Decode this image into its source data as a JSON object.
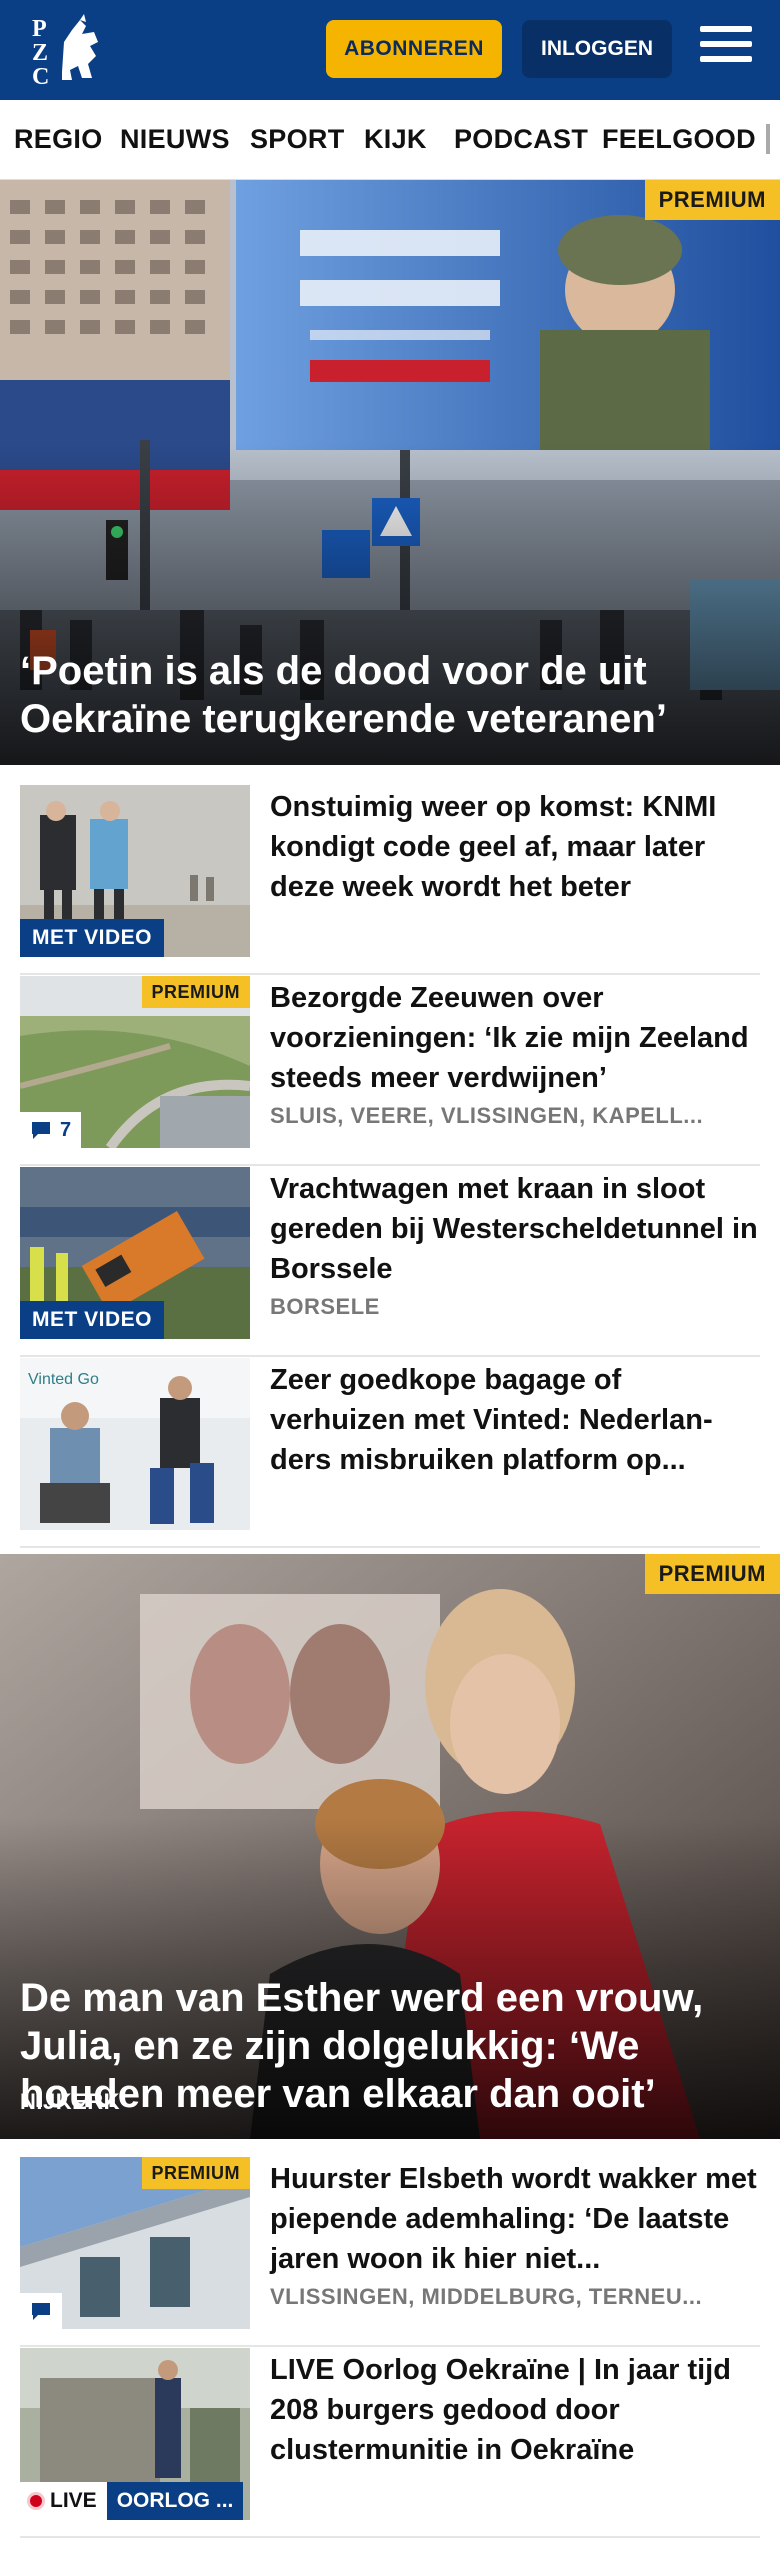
{
  "header": {
    "logo_text": "PZC",
    "subscribe_label": "ABONNEREN",
    "login_label": "INLOGGEN",
    "colors": {
      "brand": "#0a3f86",
      "accent": "#f4b400"
    }
  },
  "nav": {
    "items": [
      "REGIO",
      "NIEUWS",
      "SPORT",
      "KIJK",
      "PODCAST",
      "FEELGOOD"
    ]
  },
  "hero1": {
    "badge": "PREMIUM",
    "title": "‘Poetin is als de dood voor de uit Oekraïne terugkerende veteranen’"
  },
  "articles1": [
    {
      "title": "Onstuimig weer op komst: KNMI kondigt code geel af, maar later deze week wordt het beter",
      "label": "MET VIDEO"
    },
    {
      "title": "Bezorgde Zeeuwen over voorzieningen: ‘Ik zie mijn Zeeland steeds meer verdwijnen’",
      "badge": "PREMIUM",
      "comments": "7",
      "tags": "SLUIS, VEERE, VLISSINGEN, KAPELL..."
    },
    {
      "title": "Vrachtwagen met kraan in sloot gereden bij Westerscheldetunnel in Borssele",
      "label": "MET VIDEO",
      "tags": "BORSELE"
    },
    {
      "title": "Zeer goedkope bagage of verhuizen met Vinted: Nederlan­ders misbruiken platform op..."
    }
  ],
  "hero2": {
    "badge": "PREMIUM",
    "title": "De man van Esther werd een vrouw, Julia, en ze zijn dolgelukkig: ‘We houden meer van elkaar dan ooit’",
    "location": "NIJKERK"
  },
  "articles2": [
    {
      "title": "Huurster Elsbeth wordt wakker met piepende ademhaling: ‘De laatste jaren woon ik hier niet...",
      "badge": "PREMIUM",
      "tags": "VLISSINGEN, MIDDELBURG, TERNEU..."
    },
    {
      "title": "LIVE Oorlog Oekraïne | In jaar tijd 208 burgers gedood door clustermunitie in Oekraïne",
      "live_label": "LIVE",
      "topic_label": "OORLOG ..."
    }
  ]
}
